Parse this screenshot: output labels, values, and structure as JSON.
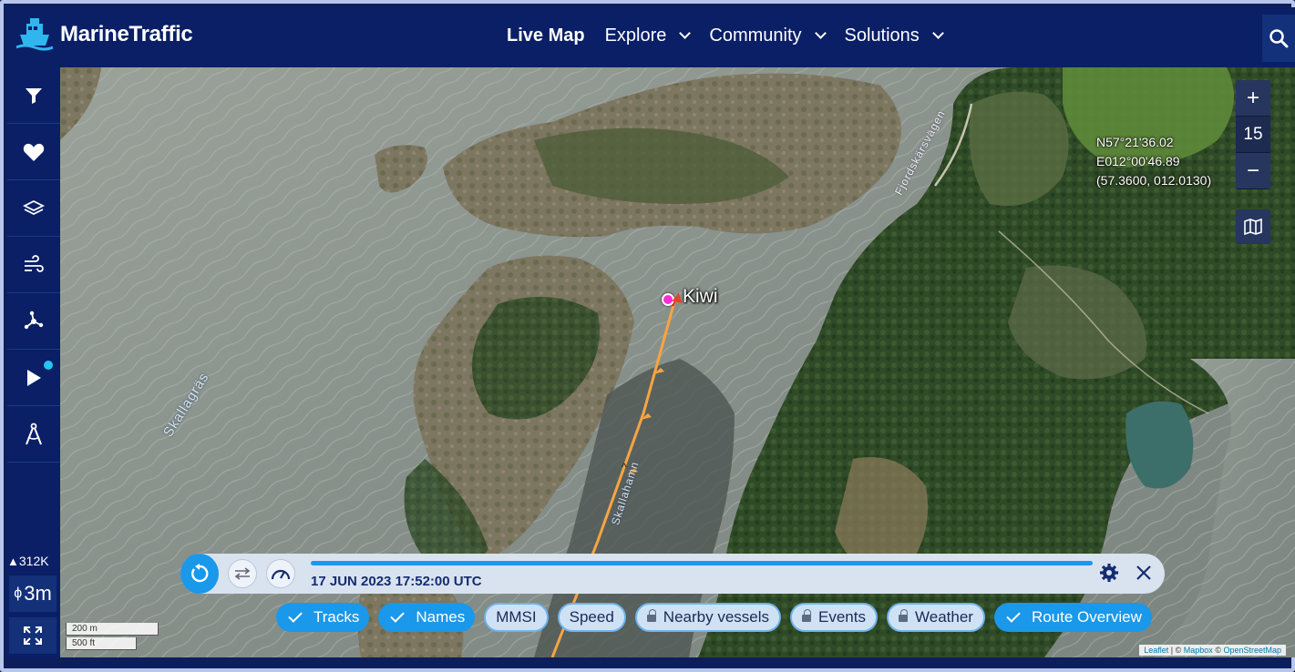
{
  "app": {
    "name": "MarineTraffic"
  },
  "nav": {
    "items": [
      {
        "label": "Live Map",
        "active": true,
        "dropdown": false
      },
      {
        "label": "Explore",
        "active": false,
        "dropdown": true
      },
      {
        "label": "Community",
        "active": false,
        "dropdown": true
      },
      {
        "label": "Solutions",
        "active": false,
        "dropdown": true
      }
    ],
    "search_icon": "search-icon"
  },
  "sidebar": {
    "buttons": [
      {
        "name": "filter",
        "icon": "filter-icon"
      },
      {
        "name": "favorites",
        "icon": "heart-icon"
      },
      {
        "name": "layers",
        "icon": "layers-icon"
      },
      {
        "name": "weather",
        "icon": "wind-icon"
      },
      {
        "name": "density",
        "icon": "network-icon"
      },
      {
        "name": "playback",
        "icon": "play-icon",
        "notification": true
      },
      {
        "name": "measure",
        "icon": "compass-icon"
      }
    ],
    "vessel_count": "312K",
    "time_interval": "3m",
    "fullscreen_icon": "expand-icon"
  },
  "map": {
    "zoom_in": "+",
    "zoom_level": "15",
    "zoom_out": "−",
    "coordinates": {
      "lat": "N57°21'36.02",
      "lon": "E012°00'46.89",
      "decimal": "(57.3600, 012.0130)"
    },
    "vessel_name": "Kiwi",
    "place_labels": [
      "Skallagräs",
      "Skallahamn",
      "Fjordskärsvägen"
    ],
    "scale": {
      "metric": "200 m",
      "imperial": "500 ft"
    },
    "attribution": {
      "leaflet": "Leaflet",
      "sep1": " | © ",
      "mapbox": "Mapbox",
      "sep2": " © ",
      "osm": "OpenStreetMap"
    }
  },
  "playback": {
    "replay_icon": "replay-icon",
    "swap_icon": "swap-icon",
    "speed_icon": "speedometer-icon",
    "timestamp": "17 JUN 2023 17:52:00 UTC",
    "progress": 1.0,
    "settings_icon": "gear-icon",
    "close_icon": "close-icon"
  },
  "toggles": [
    {
      "label": "Tracks",
      "on": true,
      "locked": false
    },
    {
      "label": "Names",
      "on": true,
      "locked": false
    },
    {
      "label": "MMSI",
      "on": false,
      "locked": false
    },
    {
      "label": "Speed",
      "on": false,
      "locked": false
    },
    {
      "label": "Nearby vessels",
      "on": false,
      "locked": true
    },
    {
      "label": "Events",
      "on": false,
      "locked": true
    },
    {
      "label": "Weather",
      "on": false,
      "locked": true
    },
    {
      "label": "Route Overview",
      "on": true,
      "locked": false
    }
  ],
  "colors": {
    "brand_navy": "#0a1f66",
    "accent_blue": "#1a98ea",
    "vessel_marker": "#ff2bd6",
    "track_orange": "#f7a542",
    "track_red": "#e9402a"
  }
}
